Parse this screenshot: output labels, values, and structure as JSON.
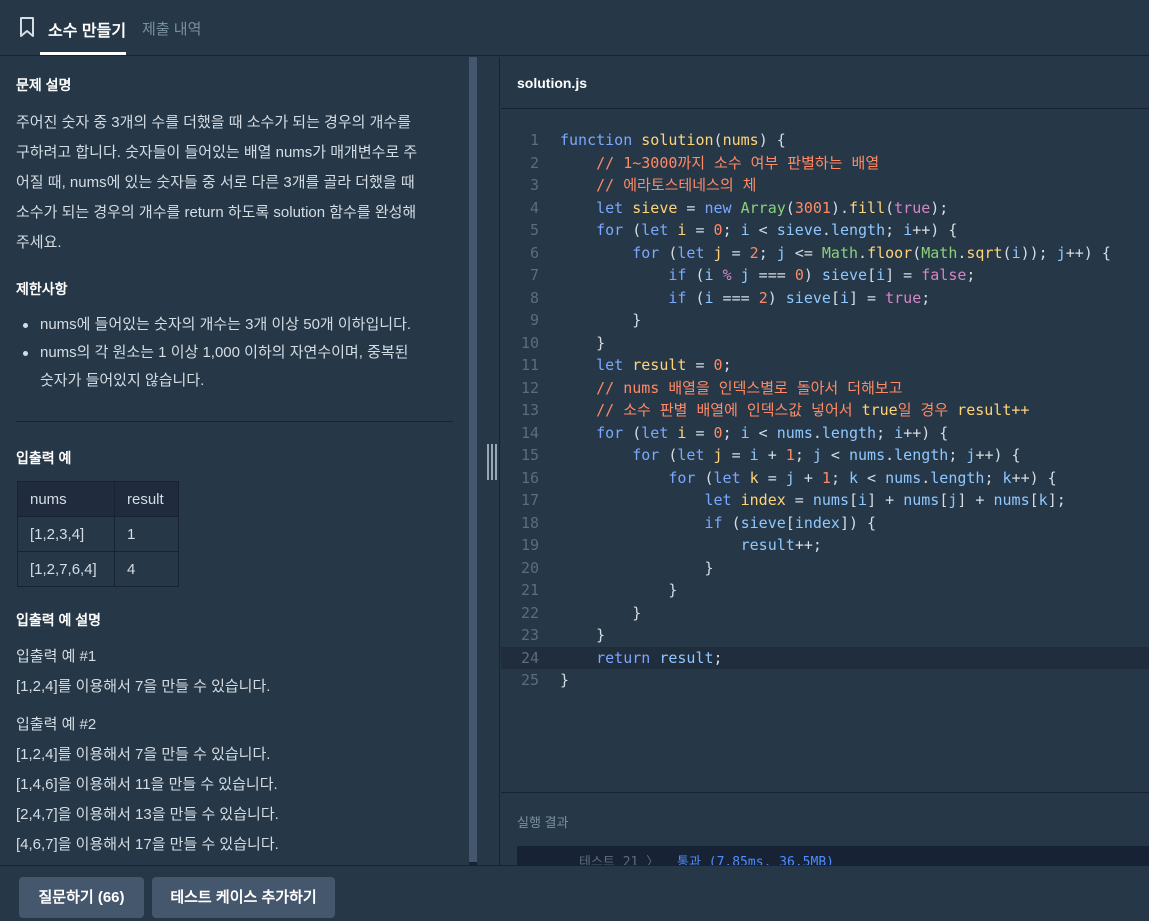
{
  "tabs": {
    "active": "소수 만들기",
    "inactive": "제출 내역"
  },
  "problem": {
    "desc_title": "문제 설명",
    "desc_lines": [
      "주어진 숫자 중 3개의 수를 더했을 때 소수가 되는 경우의 개수를",
      "구하려고 합니다. 숫자들이 들어있는 배열 nums가 매개변수로 주",
      "어질 때, nums에 있는 숫자들 중 서로 다른 3개를 골라 더했을 때",
      "소수가 되는 경우의 개수를 return 하도록 solution 함수를 완성해",
      "주세요."
    ],
    "limits_title": "제한사항",
    "limits": [
      "nums에 들어있는 숫자의 개수는 3개 이상 50개 이하입니다.",
      "nums의 각 원소는 1 이상 1,000 이하의 자연수이며, 중복된",
      "숫자가 들어있지 않습니다."
    ],
    "io_title": "입출력 예",
    "io_headers": [
      "nums",
      "result"
    ],
    "io_rows": [
      [
        "[1,2,3,4]",
        "1"
      ],
      [
        "[1,2,7,6,4]",
        "4"
      ]
    ],
    "io_explain_title": "입출력 예 설명",
    "ex1_title": "입출력 예 #1",
    "ex1_lines": [
      "[1,2,4]를 이용해서 7을 만들 수 있습니다."
    ],
    "ex2_title": "입출력 예 #2",
    "ex2_lines": [
      "[1,2,4]를 이용해서 7을 만들 수 있습니다.",
      "[1,4,6]을 이용해서 11을 만들 수 있습니다.",
      "[2,4,7]을 이용해서 13을 만들 수 있습니다.",
      "[4,6,7]을 이용해서 17을 만들 수 있습니다."
    ]
  },
  "editor": {
    "file_name": "solution.js",
    "line_numbers": [
      "1",
      "2",
      "3",
      "4",
      "5",
      "6",
      "7",
      "8",
      "9",
      "10",
      "11",
      "12",
      "13",
      "14",
      "15",
      "16",
      "17",
      "18",
      "19",
      "20",
      "21",
      "22",
      "23",
      "24",
      "25"
    ],
    "active_line": 24
  },
  "result": {
    "title": "실행 결과",
    "test_label": "테스트 21 〉",
    "test_status": "통과 (7.85ms, 36.5MB)"
  },
  "buttons": {
    "questions": "질문하기 (66)",
    "add_testcase": "테스트 케이스 추가하기"
  },
  "colors": {
    "background": "#263747",
    "dark": "#172334",
    "button": "#44576c",
    "keyword": "#7aa8ff",
    "function_name": "#ffd479",
    "comment": "#ff8a65",
    "pass": "#4d8dff"
  }
}
